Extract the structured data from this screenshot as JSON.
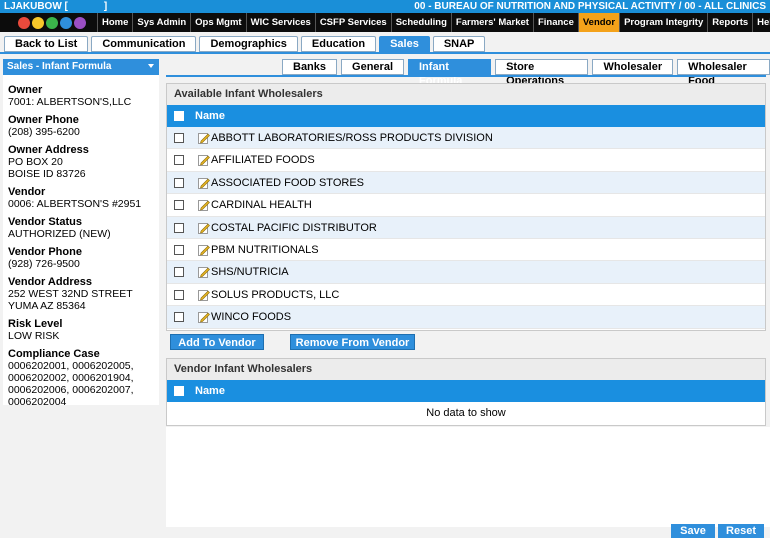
{
  "header": {
    "user": "LJAKUBOW [",
    "user_suffix": "]",
    "org": "00 - BUREAU OF NUTRITION AND PHYSICAL ACTIVITY / 00 - ALL CLINICS"
  },
  "menu": [
    {
      "label": "Home"
    },
    {
      "label": "Sys Admin"
    },
    {
      "label": "Ops Mgmt"
    },
    {
      "label": "WIC Services"
    },
    {
      "label": "CSFP Services"
    },
    {
      "label": "Scheduling"
    },
    {
      "label": "Farmers' Market"
    },
    {
      "label": "Finance"
    },
    {
      "label": "Vendor",
      "active": true
    },
    {
      "label": "Program Integrity"
    },
    {
      "label": "Reports"
    },
    {
      "label": "Help"
    }
  ],
  "tabs1": [
    {
      "label": "Back to List"
    },
    {
      "label": "Communication"
    },
    {
      "label": "Demographics"
    },
    {
      "label": "Education"
    },
    {
      "label": "Sales",
      "active": true
    },
    {
      "label": "SNAP"
    }
  ],
  "left": {
    "dropdown": "Sales - Infant Formula",
    "owner_label": "Owner",
    "owner": "7001: ALBERTSON'S,LLC",
    "owner_phone_label": "Owner Phone",
    "owner_phone": "(208) 395-6200",
    "owner_address_label": "Owner Address",
    "owner_address_1": "PO BOX 20",
    "owner_address_2": "BOISE ID 83726",
    "vendor_label": "Vendor",
    "vendor": "0006: ALBERTSON'S #2951",
    "vendor_status_label": "Vendor Status",
    "vendor_status": "AUTHORIZED (NEW)",
    "vendor_phone_label": "Vendor Phone",
    "vendor_phone": "(928) 726-9500",
    "vendor_address_label": "Vendor Address",
    "vendor_address_1": "252 WEST 32ND STREET",
    "vendor_address_2": "YUMA AZ 85364",
    "risk_label": "Risk Level",
    "risk": "LOW RISK",
    "compliance_label": "Compliance Case",
    "compliance_1": "0006202001, 0006202005,",
    "compliance_2": "0006202002, 0006201904,",
    "compliance_3": "0006202006, 0006202007,",
    "compliance_4": "0006202004"
  },
  "tabs2": [
    {
      "label": "Banks"
    },
    {
      "label": "General"
    },
    {
      "label": "Infant Formula",
      "active": true
    },
    {
      "label": "Store Operations"
    },
    {
      "label": "Wholesaler"
    },
    {
      "label": "Wholesaler Food"
    }
  ],
  "available": {
    "title": "Available Infant Wholesalers",
    "col_name": "Name",
    "rows": [
      "ABBOTT LABORATORIES/ROSS PRODUCTS DIVISION",
      "AFFILIATED FOODS",
      "ASSOCIATED FOOD STORES",
      "CARDINAL HEALTH",
      "COSTAL PACIFIC DISTRIBUTOR",
      "PBM NUTRITIONALS",
      "SHS/NUTRICIA",
      "SOLUS PRODUCTS, LLC",
      "WINCO FOODS"
    ]
  },
  "buttons": {
    "add": "Add To Vendor",
    "remove": "Remove From Vendor",
    "save": "Save",
    "reset": "Reset"
  },
  "vendor_wholesalers": {
    "title": "Vendor Infant Wholesalers",
    "col_name": "Name",
    "empty": "No data to show"
  },
  "colors": {
    "accent": "#2f8fdc",
    "menu_active": "#f4a21a",
    "menu_bg": "#0c0c0c",
    "title_bg": "#1a8fd8"
  }
}
